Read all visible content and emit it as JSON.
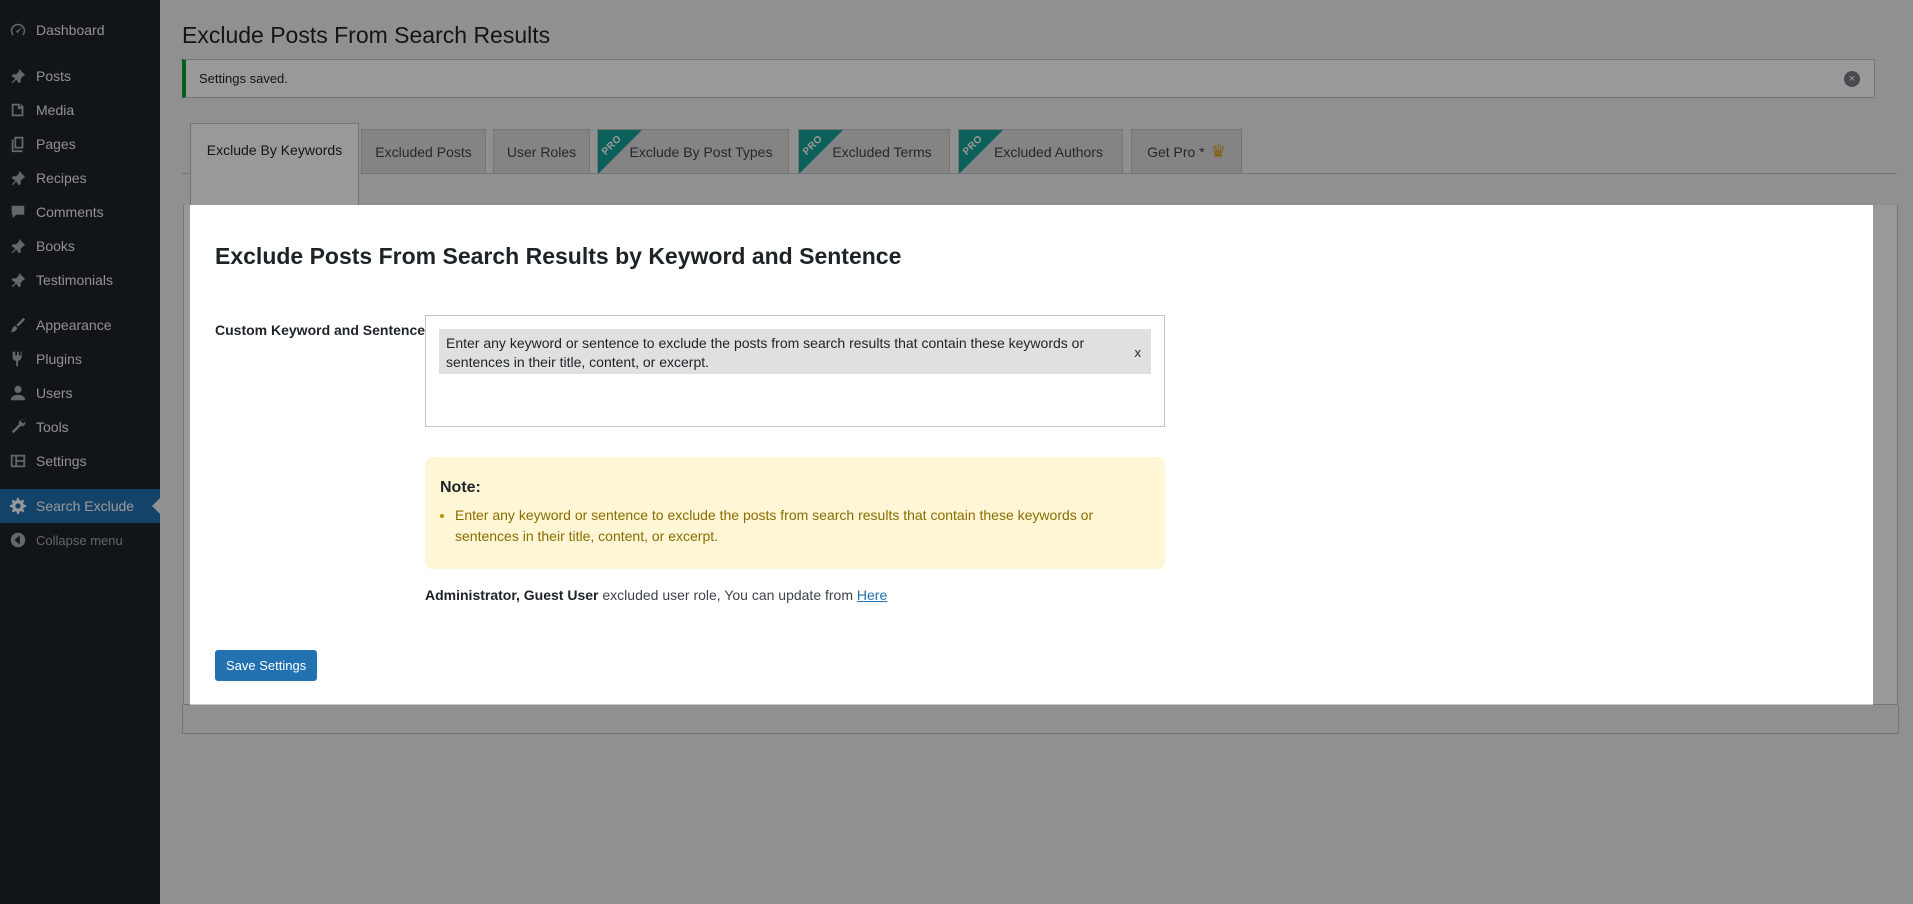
{
  "sidebar": {
    "items": [
      {
        "label": "Dashboard",
        "icon": "dashboard-icon"
      },
      {
        "label": "Posts",
        "icon": "pin-icon"
      },
      {
        "label": "Media",
        "icon": "media-icon"
      },
      {
        "label": "Pages",
        "icon": "pages-icon"
      },
      {
        "label": "Recipes",
        "icon": "pin-icon"
      },
      {
        "label": "Comments",
        "icon": "comment-icon"
      },
      {
        "label": "Books",
        "icon": "pin-icon"
      },
      {
        "label": "Testimonials",
        "icon": "pin-icon"
      },
      {
        "label": "Appearance",
        "icon": "brush-icon"
      },
      {
        "label": "Plugins",
        "icon": "plugin-icon"
      },
      {
        "label": "Users",
        "icon": "user-icon"
      },
      {
        "label": "Tools",
        "icon": "wrench-icon"
      },
      {
        "label": "Settings",
        "icon": "settings-icon"
      },
      {
        "label": "Search Exclude",
        "icon": "gear-icon",
        "current": true
      }
    ],
    "collapse_label": "Collapse menu"
  },
  "page": {
    "title": "Exclude Posts From Search Results"
  },
  "notice": {
    "text": "Settings saved.",
    "dismiss": "×"
  },
  "tabs": [
    {
      "label": "Exclude By Keywords",
      "active": true,
      "pro": false
    },
    {
      "label": "Excluded Posts",
      "active": false,
      "pro": false
    },
    {
      "label": "User Roles",
      "active": false,
      "pro": false
    },
    {
      "label": "Exclude By Post Types",
      "active": false,
      "pro": true
    },
    {
      "label": "Excluded Terms",
      "active": false,
      "pro": true
    },
    {
      "label": "Excluded Authors",
      "active": false,
      "pro": true
    },
    {
      "label": "Get Pro *",
      "active": false,
      "pro": false
    }
  ],
  "pro_badge": "PRO",
  "get_pro_icon": "crown-icon",
  "panel": {
    "title": "Exclude Posts From Search Results by Keyword and Sentence",
    "field_label": "Custom Keyword and Sentence :",
    "keyword_tag": "Enter any keyword or sentence to exclude the posts from search results that contain these keywords or sentences in their title, content, or excerpt.",
    "keyword_remove": "x",
    "note_title": "Note:",
    "note_item": "Enter any keyword or sentence to exclude the posts from search results that contain these keywords or sentences in their title, content, or excerpt.",
    "roles_bold": "Administrator, Guest User",
    "roles_text": " excluded user role, You can update from ",
    "roles_link": "Here",
    "save_label": "Save Settings"
  },
  "colors": {
    "sidebar_bg": "#1d2327",
    "accent": "#2271b1",
    "success": "#00a32a",
    "pro_ribbon": "#14a196",
    "note_bg": "#fff6d6"
  }
}
